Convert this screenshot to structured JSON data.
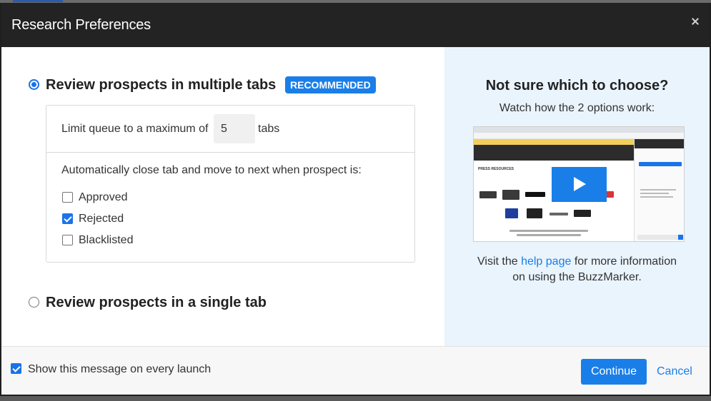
{
  "dialog": {
    "title": "Research Preferences"
  },
  "options": {
    "multiple_tabs": {
      "label": "Review prospects in multiple tabs",
      "badge": "RECOMMENDED",
      "selected": true
    },
    "single_tab": {
      "label": "Review prospects in a single tab",
      "selected": false
    }
  },
  "queue": {
    "prefix": "Limit queue to a maximum of",
    "value": "5",
    "suffix": "tabs"
  },
  "autoclose": {
    "label": "Automatically close tab and move to next when prospect is:",
    "items": [
      {
        "label": "Approved",
        "checked": false
      },
      {
        "label": "Rejected",
        "checked": true
      },
      {
        "label": "Blacklisted",
        "checked": false
      }
    ]
  },
  "help": {
    "title": "Not sure which to choose?",
    "subtitle": "Watch how the 2 options work:",
    "visit_prefix": "Visit the",
    "link_text": "help page",
    "visit_suffix_1": "for more information",
    "visit_suffix_2": "on using the BuzzMarker.",
    "video_caption": "PRESS RESOURCES"
  },
  "footer": {
    "show_every_launch": "Show this message on every launch",
    "show_checked": true,
    "continue": "Continue",
    "cancel": "Cancel"
  },
  "colors": {
    "accent": "#1a7ee8",
    "header_bg": "#232323",
    "side_panel_bg": "#eaf4fd"
  }
}
